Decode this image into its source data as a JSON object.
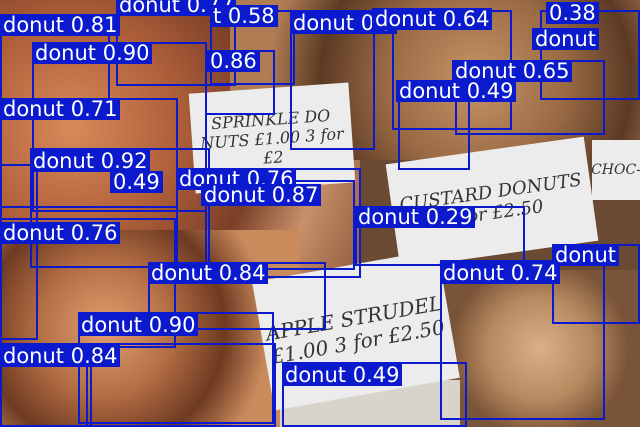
{
  "colors": {
    "box": "#0a1acc",
    "label_text": "#ffffff"
  },
  "signs": {
    "sprinkle": "SPRINKLE DO NUTS £1.00 3 for £2",
    "custard": "CUSTARD DONUTS 3 for £2.50",
    "apple": "APPLE STRUDEL £1.00 3 for £2.50",
    "choc": "CHOC-"
  },
  "detections": [
    {
      "label": "donut 0.77"
    },
    {
      "label": "t 0.58"
    },
    {
      "label": "donut 0.5"
    },
    {
      "label": "donut 0.64"
    },
    {
      "label": "0.38"
    },
    {
      "label": "donut 0.81"
    },
    {
      "label": "donut"
    },
    {
      "label": "donut 0.90"
    },
    {
      "label": "0.86"
    },
    {
      "label": "donut 0.65"
    },
    {
      "label": "donut 0.49"
    },
    {
      "label": "donut 0.71"
    },
    {
      "label": "donut 0.92"
    },
    {
      "label": "0.49"
    },
    {
      "label": "donut 0.76"
    },
    {
      "label": "donut 0.87"
    },
    {
      "label": "donut 0.29"
    },
    {
      "label": "donut 0.76"
    },
    {
      "label": "donut"
    },
    {
      "label": "donut 0.84"
    },
    {
      "label": "donut 0.74"
    },
    {
      "label": "donut 0.90"
    },
    {
      "label": "donut 0.84"
    },
    {
      "label": "donut 0.49"
    }
  ]
}
